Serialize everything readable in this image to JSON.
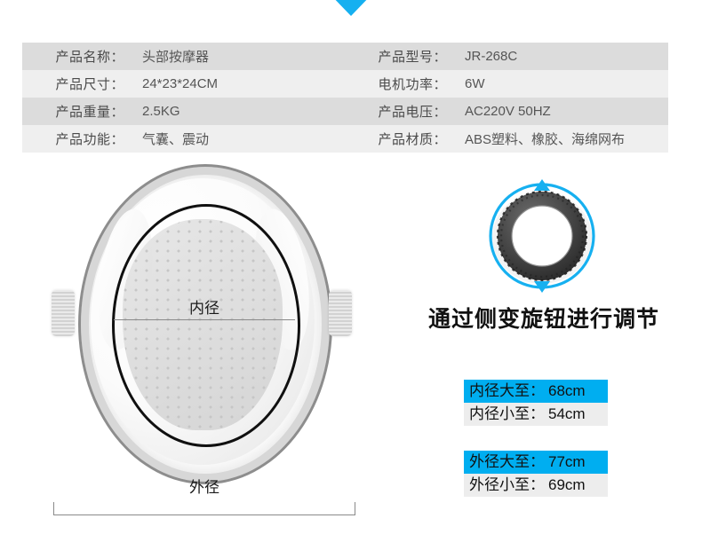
{
  "colors": {
    "accent": "#00aef0",
    "row_dark": "#dcdcdc",
    "row_light": "#efefef"
  },
  "top_pointer": {
    "icon": "triangle-down-icon"
  },
  "spec_table": {
    "rows": [
      {
        "label_left": "产品名称：",
        "value_left": "头部按摩器",
        "label_right": "产品型号：",
        "value_right": "JR-268C"
      },
      {
        "label_left": "产品尺寸：",
        "value_left": "24*23*24CM",
        "label_right": "电机功率：",
        "value_right": "6W"
      },
      {
        "label_left": "产品重量：",
        "value_left": "2.5KG",
        "label_right": "产品电压：",
        "value_right": "AC220V 50HZ"
      },
      {
        "label_left": "产品功能：",
        "value_left": "气囊、震动",
        "label_right": "产品材质：",
        "value_right": "ABS塑料、橡胶、海绵网布"
      }
    ]
  },
  "diagram": {
    "inner_diameter_label": "内径",
    "outer_diameter_label": "外径"
  },
  "knob": {
    "caption": "通过侧变旋钮进行调节",
    "rotation_icon": "circular-arrow-icon"
  },
  "measurements": {
    "inner": [
      {
        "label": "内径大至：",
        "value": "68cm",
        "highlighted": true
      },
      {
        "label": "内径小至：",
        "value": "54cm",
        "highlighted": false
      }
    ],
    "outer": [
      {
        "label": "外径大至：",
        "value": "77cm",
        "highlighted": true
      },
      {
        "label": "外径小至：",
        "value": "69cm",
        "highlighted": false
      }
    ]
  }
}
